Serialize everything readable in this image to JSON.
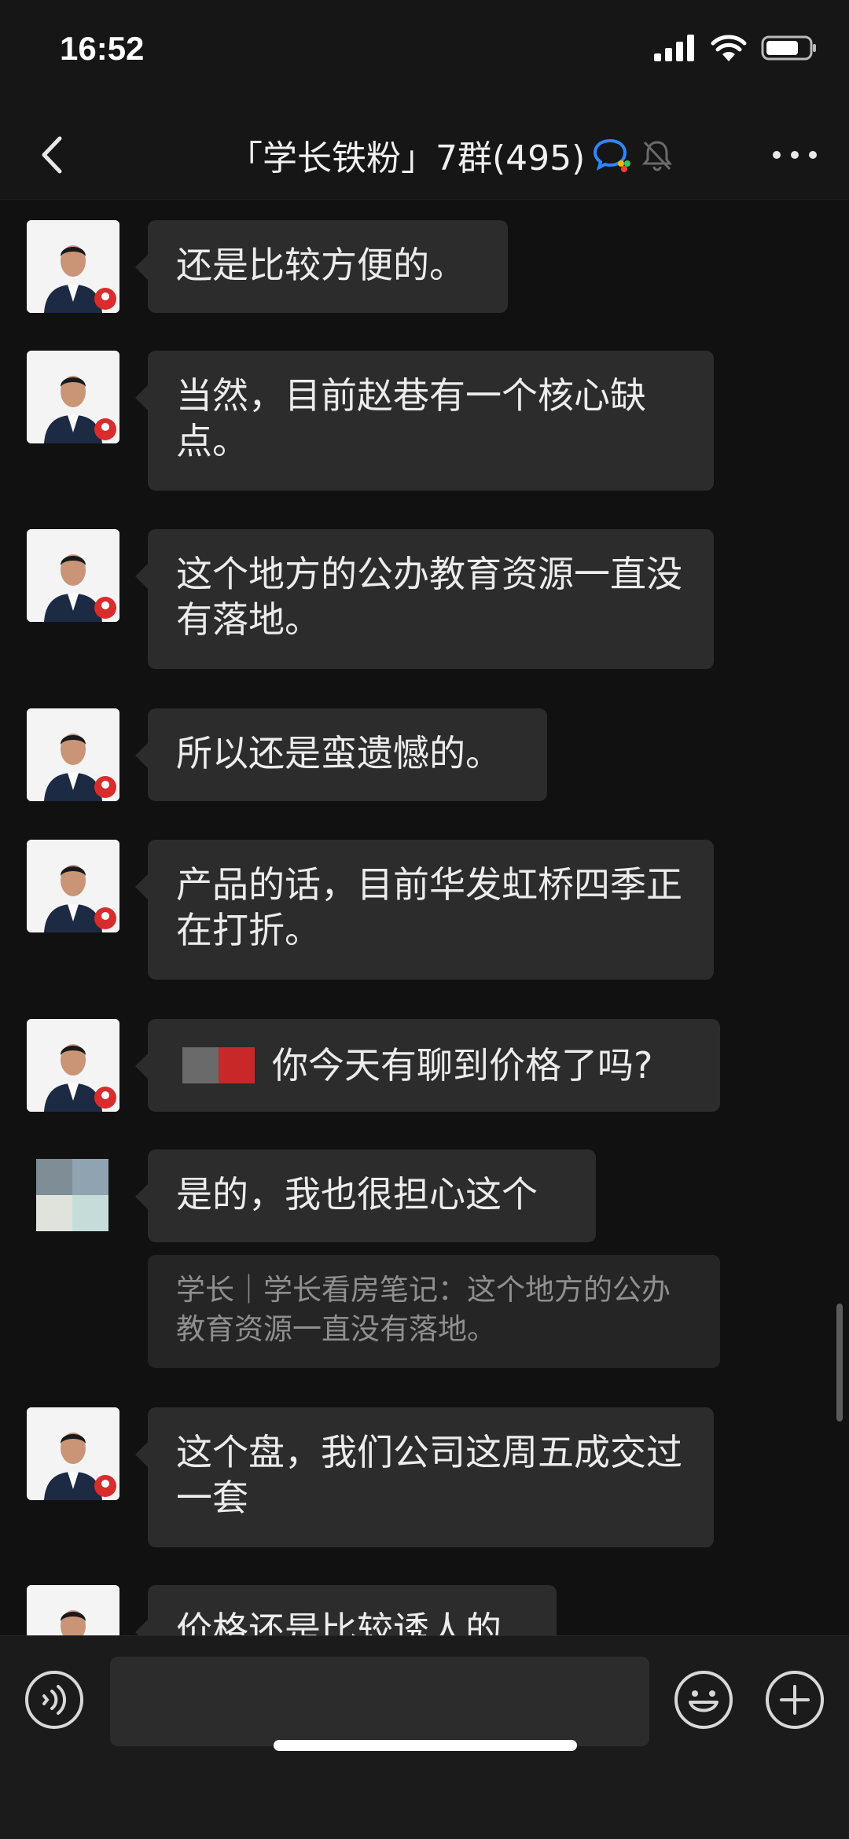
{
  "status_bar": {
    "time": "16:52"
  },
  "header": {
    "title": "「学长铁粉」7群(495)"
  },
  "messages": [
    {
      "text": "还是比较方便的。"
    },
    {
      "text": "当然，目前赵巷有一个核心缺点。"
    },
    {
      "text": "这个地方的公办教育资源一直没有落地。"
    },
    {
      "text": "所以还是蛮遗憾的。"
    },
    {
      "text": "产品的话，目前华发虹桥四季正在打折。"
    },
    {
      "text": "你今天有聊到价格了吗?"
    },
    {
      "text": "是的，我也很担心这个",
      "quote": "学长｜学长看房笔记：这个地方的公办教育资源一直没有落地。"
    },
    {
      "text": "这个盘，我们公司这周五成交过一套"
    },
    {
      "text": "价格还是比较诱人的"
    }
  ],
  "input": {
    "placeholder": ""
  },
  "colors": {
    "background": "#111111",
    "bubble": "#2c2c2c",
    "header": "#161616",
    "text": "#ececec",
    "muted": "#8f8f8f"
  }
}
